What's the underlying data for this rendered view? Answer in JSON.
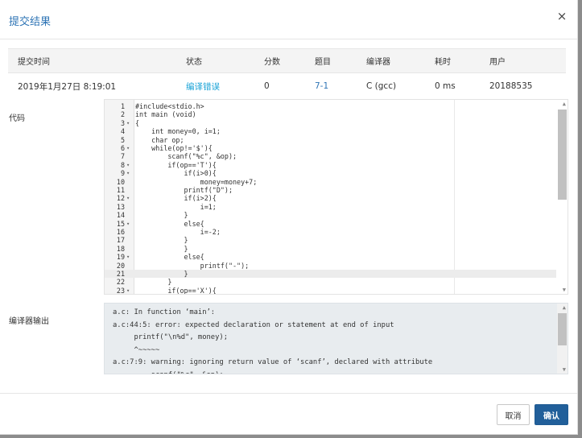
{
  "dialog": {
    "title": "提交结果",
    "close_glyph": "×"
  },
  "table": {
    "headers": [
      "提交时间",
      "状态",
      "分数",
      "题目",
      "编译器",
      "耗时",
      "用户"
    ],
    "row": {
      "time": "2019年1月27日 8:19:01",
      "status": "编译错误",
      "score": "0",
      "problem": "7-1",
      "compiler": "C (gcc)",
      "duration": "0 ms",
      "user": "20188535"
    }
  },
  "code_label": "代码",
  "code_lines": [
    {
      "n": "1",
      "fold": "",
      "text": "#include<stdio.h>"
    },
    {
      "n": "2",
      "fold": "",
      "text": "int main (void)"
    },
    {
      "n": "3",
      "fold": "▾",
      "text": "{"
    },
    {
      "n": "4",
      "fold": "",
      "text": "    int money=0, i=1;"
    },
    {
      "n": "5",
      "fold": "",
      "text": "    char op;"
    },
    {
      "n": "6",
      "fold": "▾",
      "text": "    while(op!='$'){"
    },
    {
      "n": "7",
      "fold": "",
      "text": "        scanf(\"%c\", &op);"
    },
    {
      "n": "8",
      "fold": "▾",
      "text": "        if(op=='T'){"
    },
    {
      "n": "9",
      "fold": "▾",
      "text": "            if(i>0){"
    },
    {
      "n": "10",
      "fold": "",
      "text": "                money=money+7;"
    },
    {
      "n": "11",
      "fold": "",
      "text": "            printf(\"D\");"
    },
    {
      "n": "12",
      "fold": "▾",
      "text": "            if(i>2){"
    },
    {
      "n": "13",
      "fold": "",
      "text": "                i=1;"
    },
    {
      "n": "14",
      "fold": "",
      "text": "            }"
    },
    {
      "n": "15",
      "fold": "▾",
      "text": "            else{"
    },
    {
      "n": "16",
      "fold": "",
      "text": "                i=-2;"
    },
    {
      "n": "17",
      "fold": "",
      "text": "            }"
    },
    {
      "n": "18",
      "fold": "",
      "text": "            }"
    },
    {
      "n": "19",
      "fold": "▾",
      "text": "            else{"
    },
    {
      "n": "20",
      "fold": "",
      "text": "                printf(\"-\");"
    },
    {
      "n": "21",
      "fold": "",
      "text": "            }"
    },
    {
      "n": "22",
      "fold": "",
      "text": "        }"
    },
    {
      "n": "23",
      "fold": "▾",
      "text": "        if(op=='X'){"
    }
  ],
  "output_label": "编译器输出",
  "compiler_output": [
    "a.c: In function ‘main’:",
    "a.c:44:5: error: expected declaration or statement at end of input",
    "     printf(\"\\n%d\", money);",
    "     ^~~~~~",
    "a.c:7:9: warning: ignoring return value of ‘scanf’, declared with attribute",
    "         scanf(\"%c\", &op);"
  ],
  "buttons": {
    "cancel": "取消",
    "confirm": "确认"
  },
  "colors": {
    "title": "#2e74b5",
    "status": "#17a2d6",
    "confirm_bg": "#215f9a"
  }
}
